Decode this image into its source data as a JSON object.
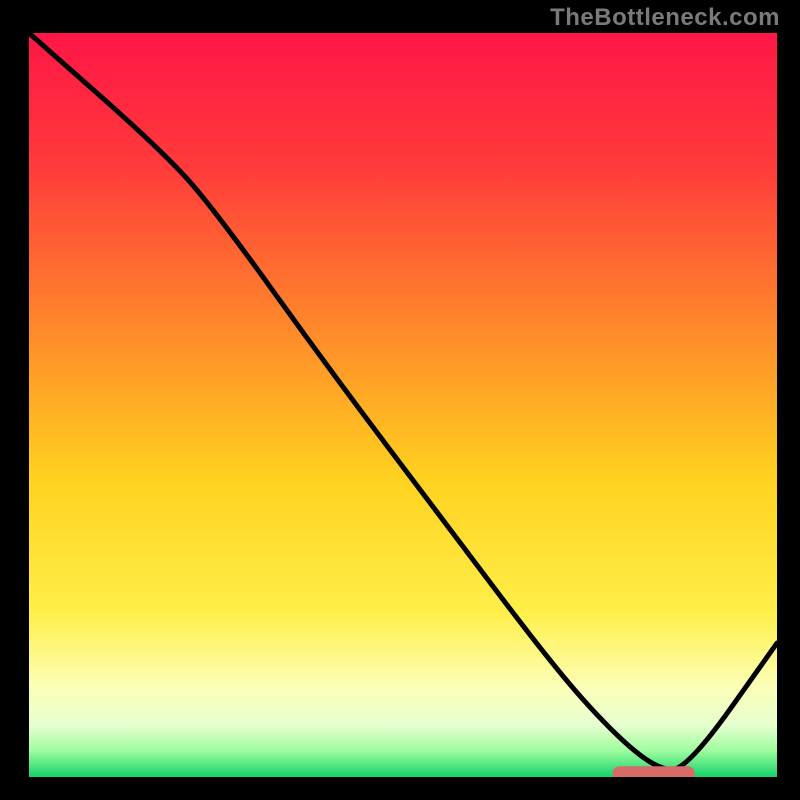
{
  "watermark": "TheBottleneck.com",
  "colors": {
    "background": "#000000",
    "curve": "#000000",
    "marker": "#d86a6a",
    "gradient_stops": [
      {
        "offset": 0,
        "color": "#ff1646"
      },
      {
        "offset": 0.18,
        "color": "#ff3b3b"
      },
      {
        "offset": 0.4,
        "color": "#ff8a2a"
      },
      {
        "offset": 0.6,
        "color": "#ffd21f"
      },
      {
        "offset": 0.78,
        "color": "#ffef4a"
      },
      {
        "offset": 0.88,
        "color": "#fbffb8"
      },
      {
        "offset": 0.93,
        "color": "#e7ffd0"
      },
      {
        "offset": 0.965,
        "color": "#9efc9e"
      },
      {
        "offset": 1.0,
        "color": "#14d36b"
      }
    ]
  },
  "chart_data": {
    "type": "line",
    "title": "",
    "xlabel": "",
    "ylabel": "",
    "xlim": [
      0,
      100
    ],
    "ylim": [
      0,
      100
    ],
    "grid": false,
    "legend": null,
    "series": [
      {
        "name": "bottleneck-curve",
        "x": [
          0,
          18,
          25,
          40,
          55,
          70,
          78,
          84,
          88,
          100
        ],
        "values": [
          100,
          84,
          76,
          55,
          35,
          15,
          6,
          1,
          1,
          18
        ]
      }
    ],
    "annotations": [
      {
        "name": "optimal-range-marker",
        "shape": "rounded-bar",
        "x_start": 78,
        "x_end": 89,
        "y": 0.5
      }
    ]
  }
}
